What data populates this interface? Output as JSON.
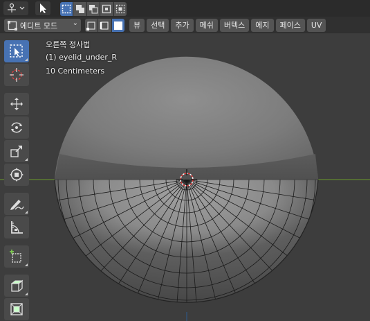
{
  "header": {
    "edit_mode_label": "에디트 모드",
    "menu_items": [
      "뷰",
      "선택",
      "추가",
      "메쉬",
      "버텍스",
      "에지",
      "페이스",
      "UV"
    ]
  },
  "viewport": {
    "view_name": "오른쪽 정사법",
    "object_label": "(1) eyelid_under_R",
    "scale_label": "10 Centimeters"
  },
  "colors": {
    "accent": "#4772b3",
    "background": "#3d3d3d",
    "grid_line": "#6b9a2c"
  },
  "toolbar": {
    "tools": [
      "select-box-icon",
      "cursor-icon",
      "move-icon",
      "rotate-icon",
      "scale-icon",
      "transform-icon",
      "annotate-icon",
      "measure-icon",
      "add-cube-icon",
      "extrude-icon",
      "inset-icon"
    ]
  }
}
